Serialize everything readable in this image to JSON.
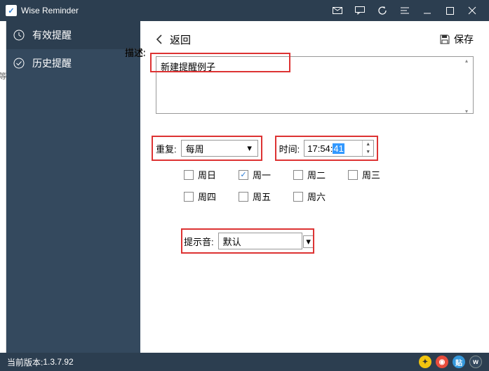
{
  "app": {
    "title": "Wise Reminder"
  },
  "sidebar": {
    "items": [
      {
        "label": "有效提醒"
      },
      {
        "label": "历史提醒"
      }
    ]
  },
  "toolbar": {
    "back": "返回",
    "save": "保存"
  },
  "form": {
    "desc_label": "描述:",
    "desc_value": "新建提醒例子",
    "repeat_label": "重复:",
    "repeat_value": "每周",
    "time_label": "时间:",
    "time_hhmm": "17:54:",
    "time_sel": "41",
    "sound_label": "提示音:",
    "sound_value": "默认"
  },
  "days": {
    "row1": [
      {
        "label": "周日",
        "checked": false
      },
      {
        "label": "周一",
        "checked": true
      },
      {
        "label": "周二",
        "checked": false
      },
      {
        "label": "周三",
        "checked": false
      }
    ],
    "row2": [
      {
        "label": "周四",
        "checked": false
      },
      {
        "label": "周五",
        "checked": false
      },
      {
        "label": "周六",
        "checked": false
      }
    ]
  },
  "status": {
    "version_label": "当前版本:",
    "version": "1.3.7.92"
  },
  "leftedge": "等"
}
